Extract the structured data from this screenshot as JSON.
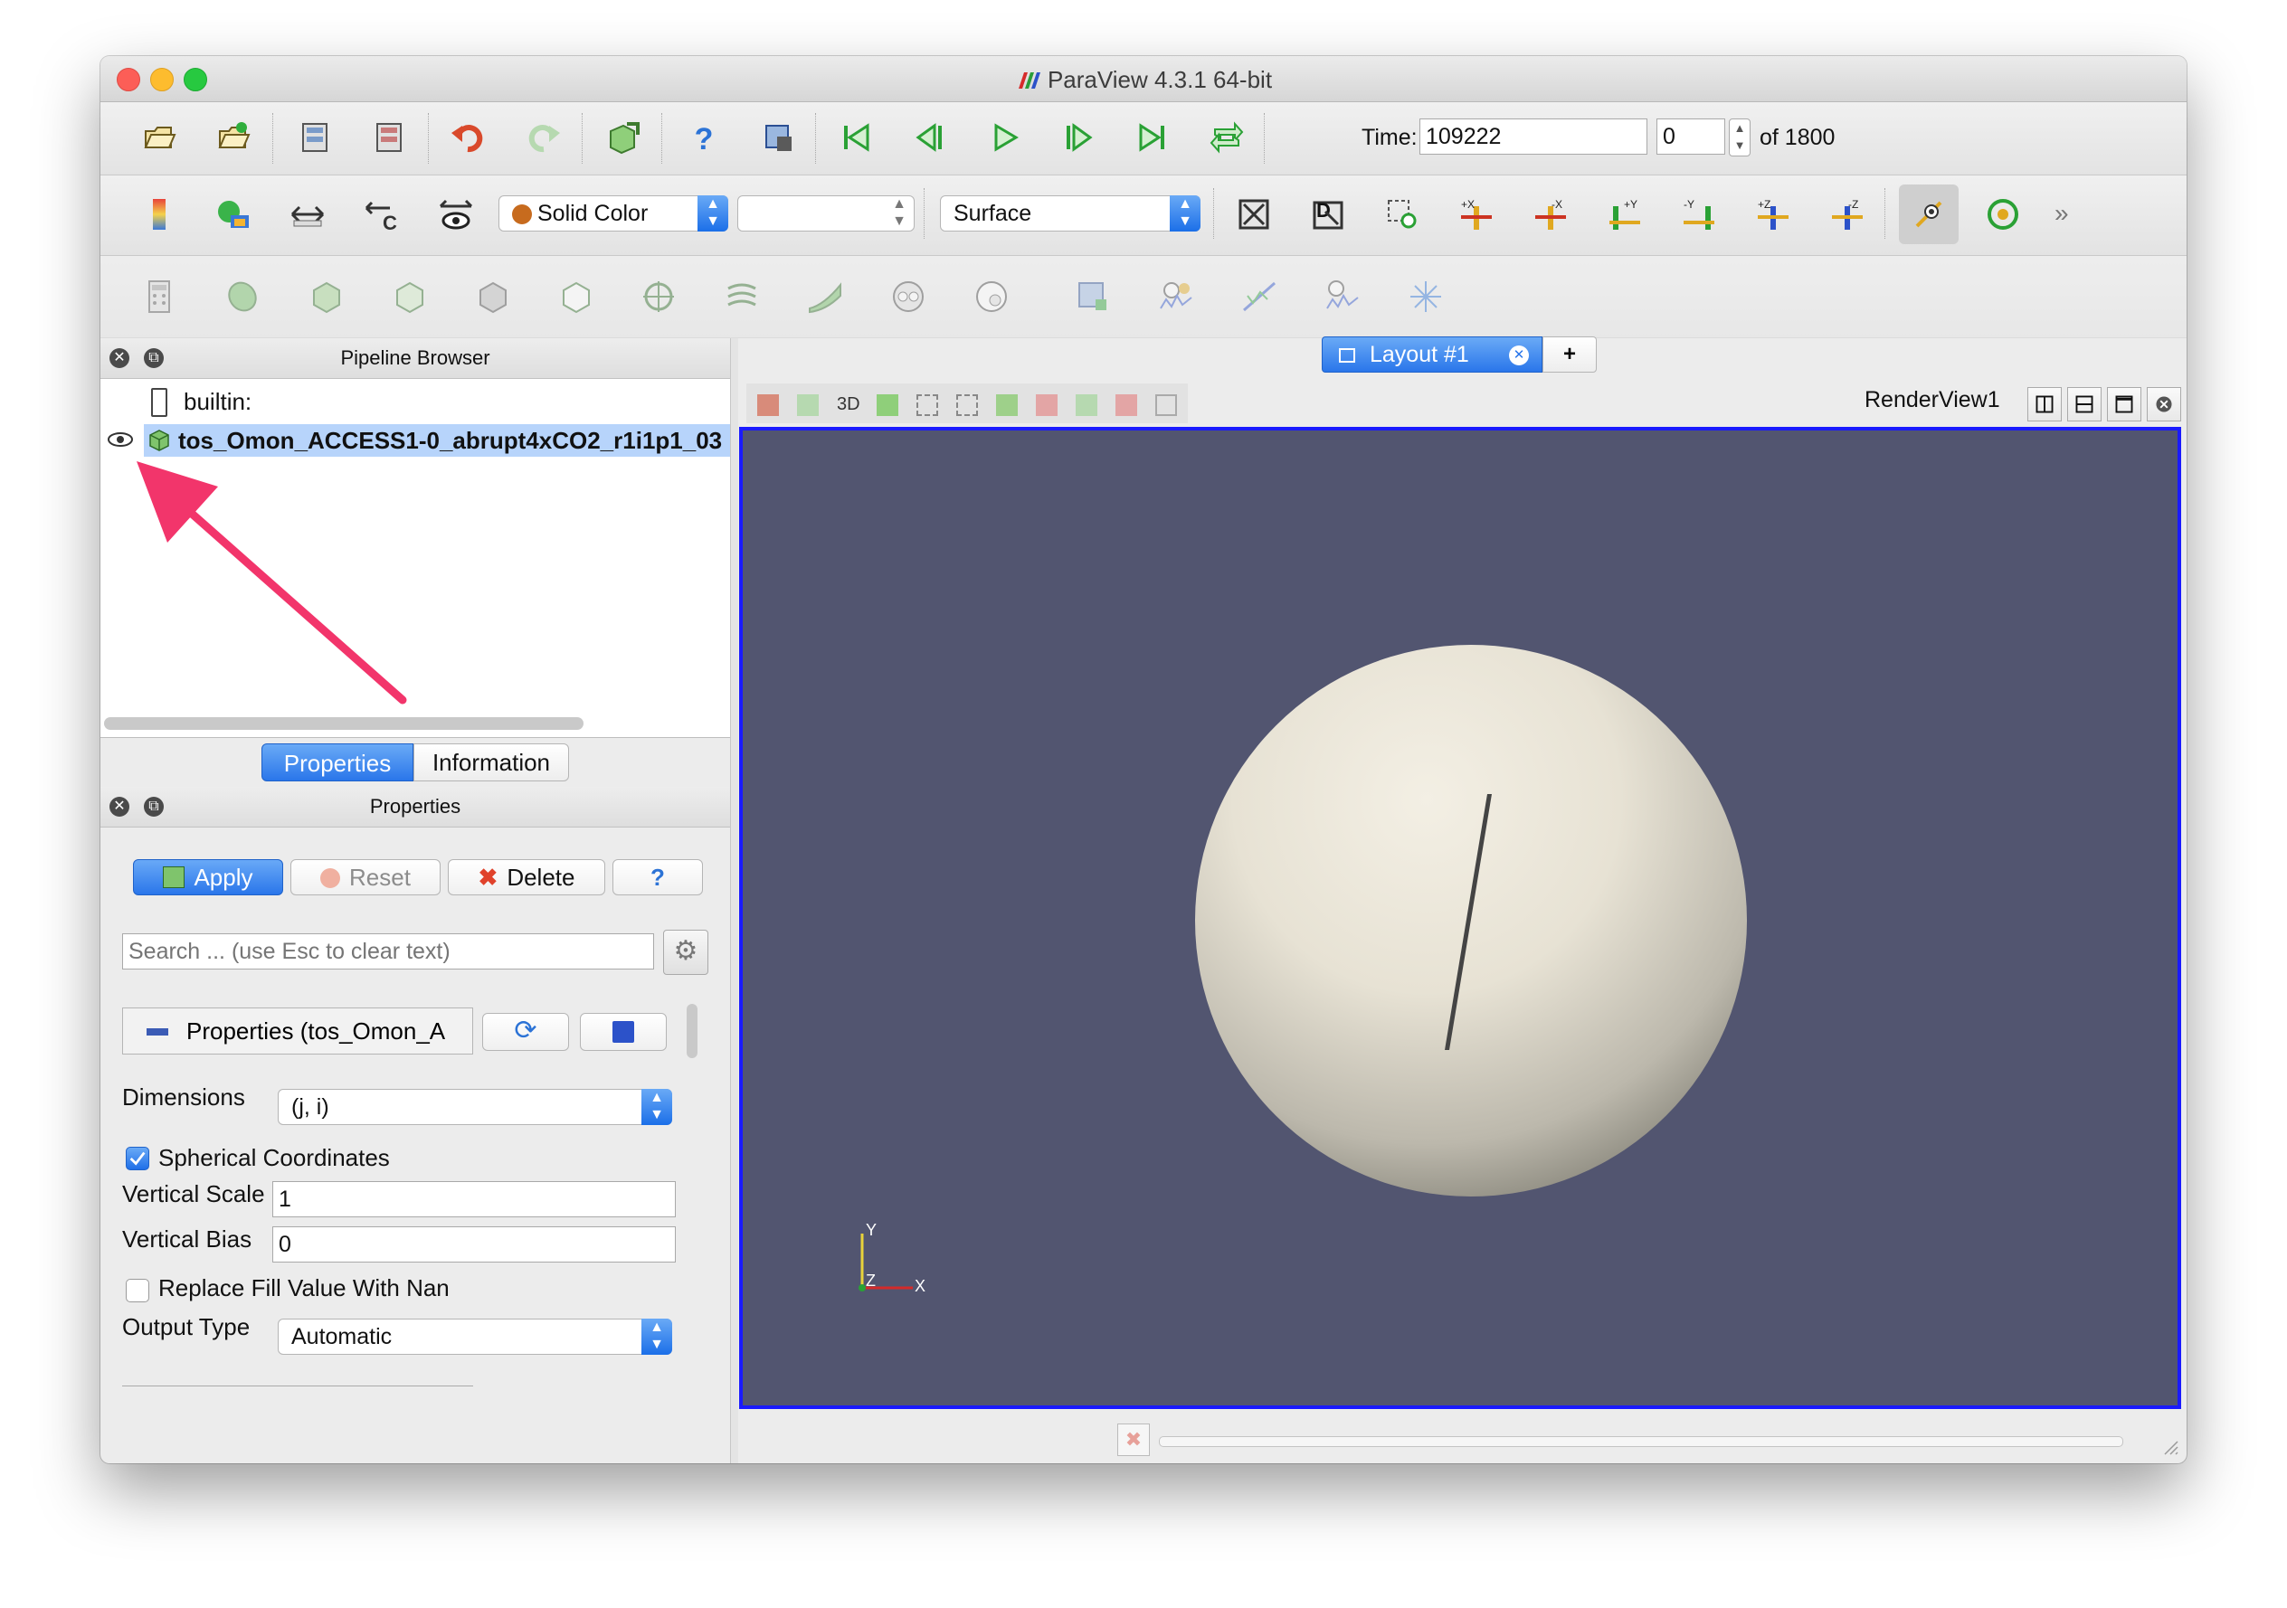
{
  "window": {
    "title": "ParaView 4.3.1 64-bit"
  },
  "toolbar1": {
    "buttons": [
      "open-file",
      "load-state",
      "connect",
      "disconnect",
      "undo",
      "redo",
      "toggle-camera",
      "help",
      "data-selection",
      "first-frame",
      "previous-frame",
      "play",
      "next-frame",
      "last-frame",
      "loop"
    ],
    "time_label": "Time:",
    "time_value": "109222",
    "timestep_value": "0",
    "of_total": "of 1800"
  },
  "toolbar2": {
    "color_mode": "Solid Color",
    "color_component": "",
    "representation": "Surface",
    "camera_buttons": [
      "+X",
      "-X",
      "+Y",
      "-Y",
      "+Z",
      "-Z"
    ]
  },
  "pipeline": {
    "title": "Pipeline Browser",
    "items": [
      {
        "label": "builtin:"
      },
      {
        "label": "tos_Omon_ACCESS1-0_abrupt4xCO2_r1i1p1_03"
      }
    ]
  },
  "tabs": {
    "properties": "Properties",
    "information": "Information"
  },
  "properties": {
    "title": "Properties",
    "apply": "Apply",
    "reset": "Reset",
    "delete": "Delete",
    "help": "?",
    "search_placeholder": "Search ... (use Esc to clear text)",
    "section_label": "Properties (tos_Omon_A",
    "dimensions_label": "Dimensions",
    "dimensions_value": "(j, i)",
    "spherical_label": "Spherical Coordinates",
    "spherical_checked": true,
    "vertical_scale_label": "Vertical Scale",
    "vertical_scale_value": "1",
    "vertical_bias_label": "Vertical Bias",
    "vertical_bias_value": "0",
    "replace_fill_label": "Replace Fill Value With Nan",
    "replace_fill_checked": false,
    "output_type_label": "Output Type",
    "output_type_value": "Automatic"
  },
  "layout": {
    "tab_label": "Layout #1",
    "add_tab": "+",
    "render_view_label": "RenderView1",
    "toolbar_3d": "3D",
    "background_color": "#525570",
    "border_color": "#1a1aff"
  },
  "axes": {
    "x": "X",
    "y": "Y",
    "z": "Z"
  },
  "colors": {
    "accent": "#2a76ea",
    "annotation_arrow": "#f2356b"
  }
}
